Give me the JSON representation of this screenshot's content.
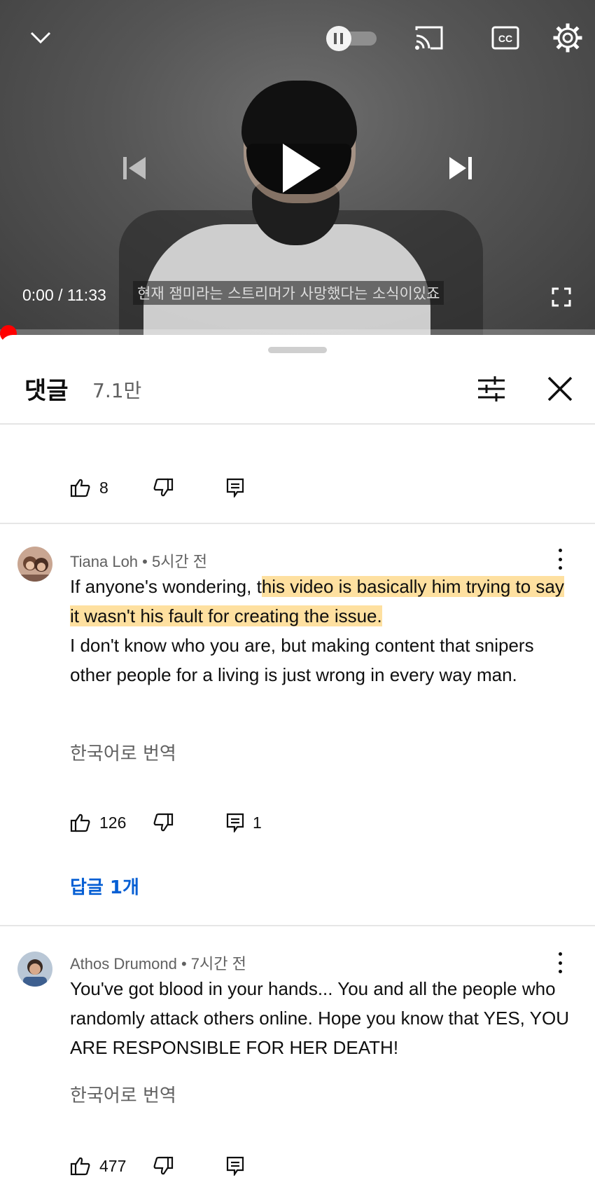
{
  "player": {
    "timecode": "0:00 / 11:33",
    "subtitle": "현재 잼미라는 스트리머가 사망했다는 소식이있죠",
    "progress": 0,
    "icons": [
      "chevron-down-icon",
      "pause-toggle-icon",
      "cast-icon",
      "cc-icon",
      "settings-icon",
      "previous-icon",
      "play-icon",
      "next-icon",
      "fullscreen-icon"
    ]
  },
  "comments_panel": {
    "title": "댓글",
    "count": "7.1만",
    "prev_comment": {
      "likes": "8"
    },
    "comments": [
      {
        "author": "Tiana Loh",
        "time": "5시간 전",
        "text_plain_1": "If anyone's wondering, t",
        "text_highlight": "his video is basically him trying to say it wasn't his fault for creating the issue.",
        "text_plain_2": "I don't know who you are, but making content that snipers other people for a living is just wrong in every way man.",
        "translate": "한국어로 번역",
        "likes": "126",
        "reply_count": "1",
        "replies_link": "답글 1개"
      },
      {
        "author": "Athos Drumond",
        "time": "7시간 전",
        "text": "You've got blood in your hands... You and all the people who randomly attack others online. Hope you know that YES, YOU ARE RESPONSIBLE FOR HER DEATH!",
        "translate": "한국어로 번역",
        "likes": "477"
      }
    ]
  },
  "colors": {
    "accent": "#065fd4",
    "progress": "#ff0000",
    "highlight": "#fdd680"
  }
}
